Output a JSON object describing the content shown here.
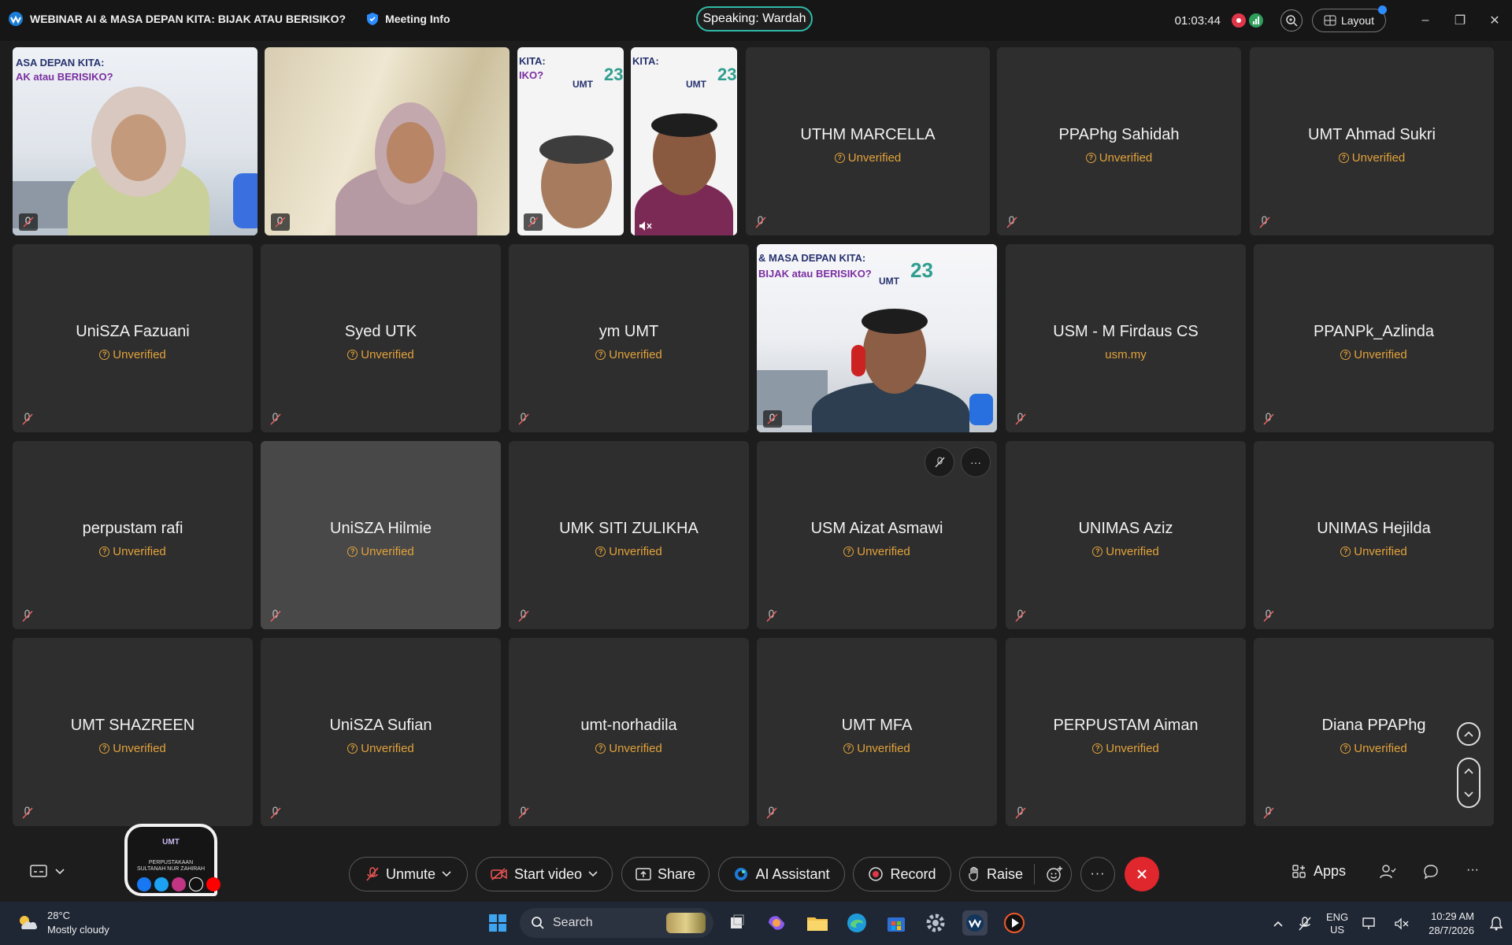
{
  "titlebar": {
    "meeting_title": "WEBINAR AI & MASA DEPAN KITA: BIJAK ATAU BERISIKO?",
    "meeting_info_label": "Meeting Info",
    "speaking_label": "Speaking: Wardah",
    "timer": "01:03:44",
    "layout_label": "Layout"
  },
  "video_overlays": {
    "banner_line1": "ASA DEPAN KITA:",
    "banner_line2": "AK atau BERISIKO?",
    "banner_short": "KITA:",
    "banner_short2": "IKO?",
    "umt": "UMT",
    "anniv": "23",
    "big_banner_line1": "& MASA DEPAN KITA:",
    "big_banner_line2": "BIJAK atau BERISIKO?"
  },
  "participants": [
    {
      "name": "UTHM MARCELLA",
      "status": "Unverified"
    },
    {
      "name": "PPAPhg Sahidah",
      "status": "Unverified"
    },
    {
      "name": "UMT Ahmad Sukri",
      "status": "Unverified"
    },
    {
      "name": "UniSZA Fazuani",
      "status": "Unverified"
    },
    {
      "name": "Syed UTK",
      "status": "Unverified"
    },
    {
      "name": "ym UMT",
      "status": "Unverified"
    },
    {
      "name": "USM - M Firdaus CS",
      "status": "usm.my"
    },
    {
      "name": "PPANPk_Azlinda",
      "status": "Unverified"
    },
    {
      "name": "perpustam rafi",
      "status": "Unverified"
    },
    {
      "name": "UniSZA Hilmie",
      "status": "Unverified"
    },
    {
      "name": "UMK SITI ZULIKHA",
      "status": "Unverified"
    },
    {
      "name": "USM Aizat Asmawi",
      "status": "Unverified"
    },
    {
      "name": "UNIMAS Aziz",
      "status": "Unverified"
    },
    {
      "name": "UNIMAS Hejilda",
      "status": "Unverified"
    },
    {
      "name": "UMT SHAZREEN",
      "status": "Unverified"
    },
    {
      "name": "UniSZA Sufian",
      "status": "Unverified"
    },
    {
      "name": "umt-norhadila",
      "status": "Unverified"
    },
    {
      "name": "UMT MFA",
      "status": "Unverified"
    },
    {
      "name": "PERPUSTAM Aiman",
      "status": "Unverified"
    },
    {
      "name": "Diana PPAPhg",
      "status": "Unverified"
    }
  ],
  "logo_card": {
    "line1": "UMT",
    "line2": "PERPUSTAKAAN",
    "line3": "SULTANAH NUR ZAHIRAH"
  },
  "controls": {
    "unmute": "Unmute",
    "start_video": "Start video",
    "share": "Share",
    "ai_assistant": "AI Assistant",
    "record": "Record",
    "raise": "Raise",
    "apps": "Apps"
  },
  "taskbar": {
    "temperature": "28°C",
    "weather": "Mostly cloudy",
    "search_placeholder": "Search",
    "lang_top": "ENG",
    "lang_bottom": "US",
    "time": "10:29 AM",
    "date": "28/7/2026"
  },
  "colors": {
    "accent_teal": "#2fb8a6",
    "unverified": "#e2a23b",
    "leave_red": "#e0272e",
    "record_red": "#e0364a"
  }
}
